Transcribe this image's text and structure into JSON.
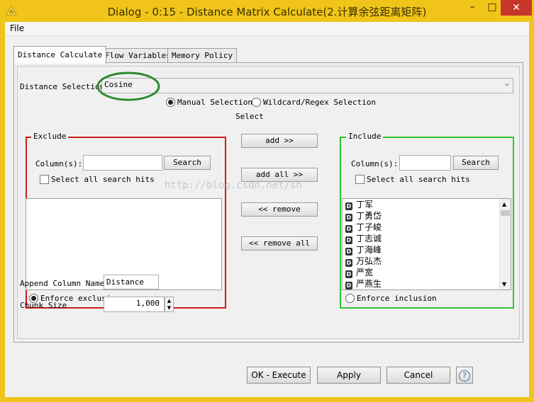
{
  "window": {
    "title": "Dialog - 0:15 - Distance Matrix Calculate(2.计算余弦距离矩阵)",
    "min": "–",
    "max": "□",
    "close": "✕"
  },
  "menu": {
    "file": "File"
  },
  "tabs": [
    "Distance Calculate",
    "Flow Variables",
    "Memory Policy"
  ],
  "distance_selection": {
    "label": "Distance Selection",
    "value": "Cosine"
  },
  "selection_mode": {
    "manual": "Manual Selection",
    "wildcard": "Wildcard/Regex Selection",
    "selected": "manual"
  },
  "exclude": {
    "title": "Exclude",
    "columns_label": "Column(s):",
    "search_value": "",
    "search_button": "Search",
    "select_all": "Select all search hits",
    "enforce": "Enforce exclusion",
    "enforce_selected": true
  },
  "select": {
    "title": "Select",
    "add": "add >>",
    "add_all": "add all >>",
    "remove": "<< remove",
    "remove_all": "<< remove all"
  },
  "include": {
    "title": "Include",
    "columns_label": "Column(s):",
    "search_value": "",
    "search_button": "Search",
    "select_all": "Select all search hits",
    "enforce": "Enforce inclusion",
    "enforce_selected": false,
    "items": [
      "丁军",
      "丁勇岱",
      "丁子峻",
      "丁志诚",
      "丁海峰",
      "万弘杰",
      "严宽",
      "严燕生"
    ],
    "item_icon": "D"
  },
  "append_column": {
    "label": "Append Column Name",
    "value": "Distance"
  },
  "chunk_size": {
    "label": "Chunk Size",
    "value": "1,000"
  },
  "footer": {
    "ok": "OK - Execute",
    "apply": "Apply",
    "cancel": "Cancel",
    "help": "?"
  },
  "watermark": "http://blog.csdn.net/sh",
  "colors": {
    "titlebar": "#f0c419",
    "close": "#c7362b",
    "exclude_border": "#cc1f1f",
    "include_border": "#2fc72f",
    "annotation_circle": "#2e8b2e"
  }
}
